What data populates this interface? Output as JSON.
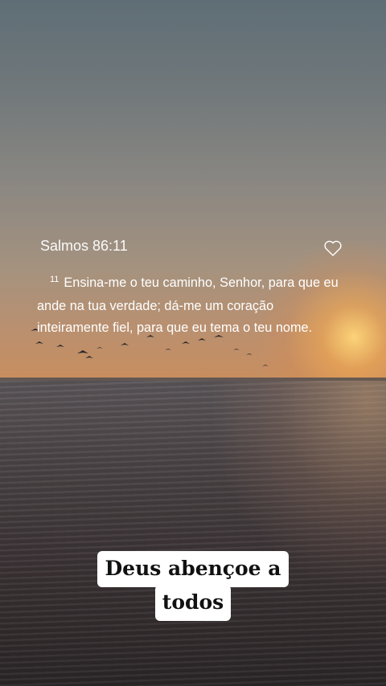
{
  "verse": {
    "reference": "Salmos 86:11",
    "number": "11",
    "text": "Ensina-me o teu caminho, Senhor, para que eu ande na tua verdade; dá-me um coração inteiramente fiel, para que eu tema o teu nome."
  },
  "icons": {
    "favorite": "heart-outline-icon"
  },
  "caption": {
    "line1": "Deus abençoe a",
    "line2": "todos"
  },
  "colors": {
    "text": "#ffffff",
    "caption_bg": "#ffffff",
    "caption_text": "#111111"
  }
}
